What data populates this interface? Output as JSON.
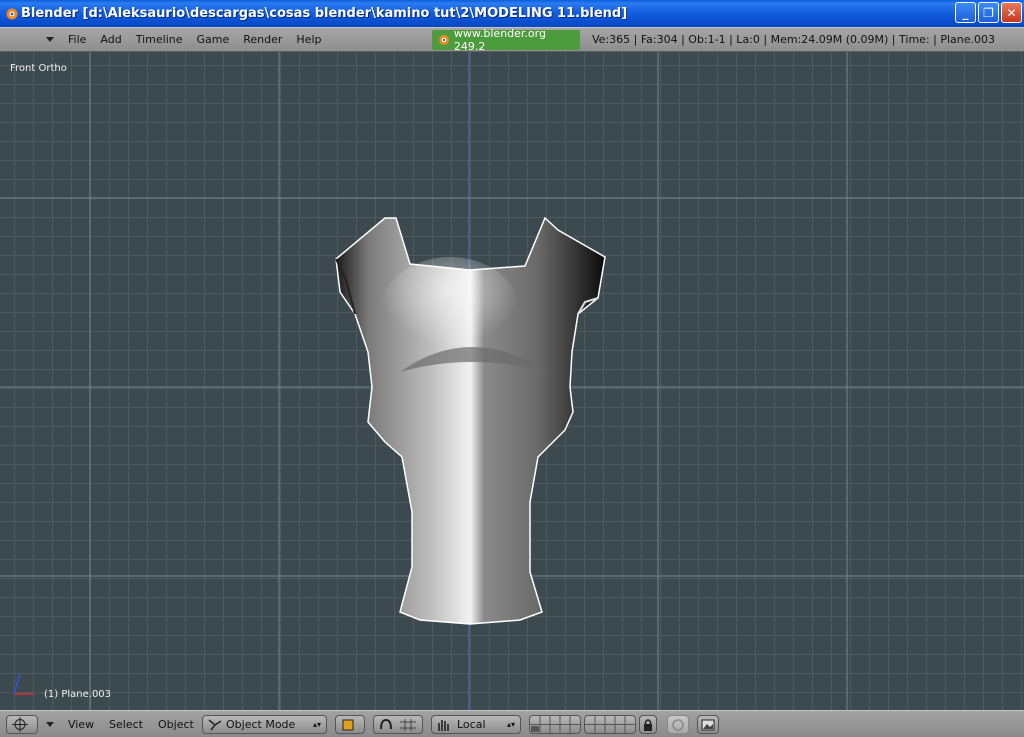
{
  "window": {
    "title": "Blender [d:\\Aleksaurio\\descargas\\cosas blender\\kamino tut\\2\\MODELING 11.blend]",
    "minimize": "_",
    "maximize": "❐",
    "close": "✕"
  },
  "menu": [
    "File",
    "Add",
    "Timeline",
    "Game",
    "Render",
    "Help"
  ],
  "site": "www.blender.org 249.2",
  "stats": "Ve:365 | Fa:304 | Ob:1-1 | La:0  | Mem:24.09M (0.09M)  | Time:  | Plane.003",
  "viewport": {
    "view_label": "Front Ortho",
    "object_label": "(1) Plane.003"
  },
  "bottom": {
    "view": "View",
    "select": "Select",
    "object": "Object",
    "mode": "Object Mode",
    "pivot": "Local"
  },
  "colors": {
    "titlebar": "#0b5ddc",
    "viewport_bg": "#3c4a50",
    "site_bg": "#4c9c3e"
  }
}
